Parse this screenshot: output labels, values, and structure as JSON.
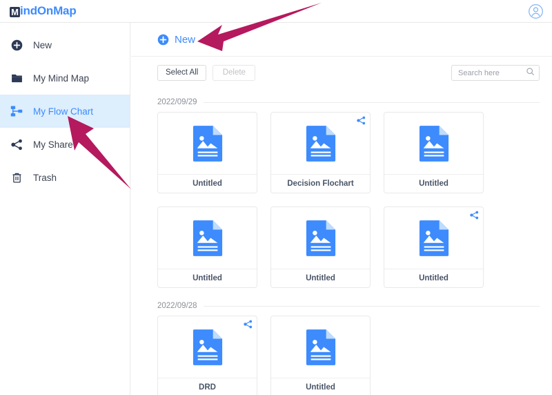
{
  "colors": {
    "brand_blue": "#3d8bfd",
    "icon_blue": "#3d8bfd",
    "active_bg": "#ddeefd",
    "arrow": "#b5195e",
    "text": "#3c4353",
    "muted": "#8b8f98"
  },
  "topbar": {
    "logo_initial": "M",
    "logo_rest": "indOnMap",
    "avatar_icon": "user-avatar-icon"
  },
  "sidebar": {
    "items": [
      {
        "label": "New",
        "icon": "plus-circle-icon",
        "active": false
      },
      {
        "label": "My Mind Map",
        "icon": "folder-icon",
        "active": false
      },
      {
        "label": "My Flow Chart",
        "icon": "flow-chart-icon",
        "active": true
      },
      {
        "label": "My Share",
        "icon": "share-icon",
        "active": false
      },
      {
        "label": "Trash",
        "icon": "trash-icon",
        "active": false
      }
    ]
  },
  "main": {
    "new_button": {
      "label": "New",
      "icon": "plus-circle-icon"
    },
    "toolbar": {
      "select_all_label": "Select All",
      "delete_label": "Delete",
      "delete_disabled": true
    },
    "search": {
      "placeholder": "Search here",
      "value": "",
      "icon": "search-icon"
    },
    "groups": [
      {
        "date": "2022/09/29",
        "cards": [
          {
            "name": "Untitled",
            "icon": "document-image-icon",
            "shared": false
          },
          {
            "name": "Decision Flochart",
            "icon": "document-image-icon",
            "shared": true
          },
          {
            "name": "Untitled",
            "icon": "document-image-icon",
            "shared": false
          },
          {
            "name": "Untitled",
            "icon": "document-image-icon",
            "shared": false
          },
          {
            "name": "Untitled",
            "icon": "document-image-icon",
            "shared": false
          },
          {
            "name": "Untitled",
            "icon": "document-image-icon",
            "shared": true
          }
        ]
      },
      {
        "date": "2022/09/28",
        "cards": [
          {
            "name": "DRD",
            "icon": "document-image-icon",
            "shared": true
          },
          {
            "name": "Untitled",
            "icon": "document-image-icon",
            "shared": false
          }
        ]
      }
    ]
  },
  "annotations": [
    {
      "name": "arrow-pointing-to-new-button"
    },
    {
      "name": "arrow-pointing-to-my-flow-chart"
    }
  ]
}
